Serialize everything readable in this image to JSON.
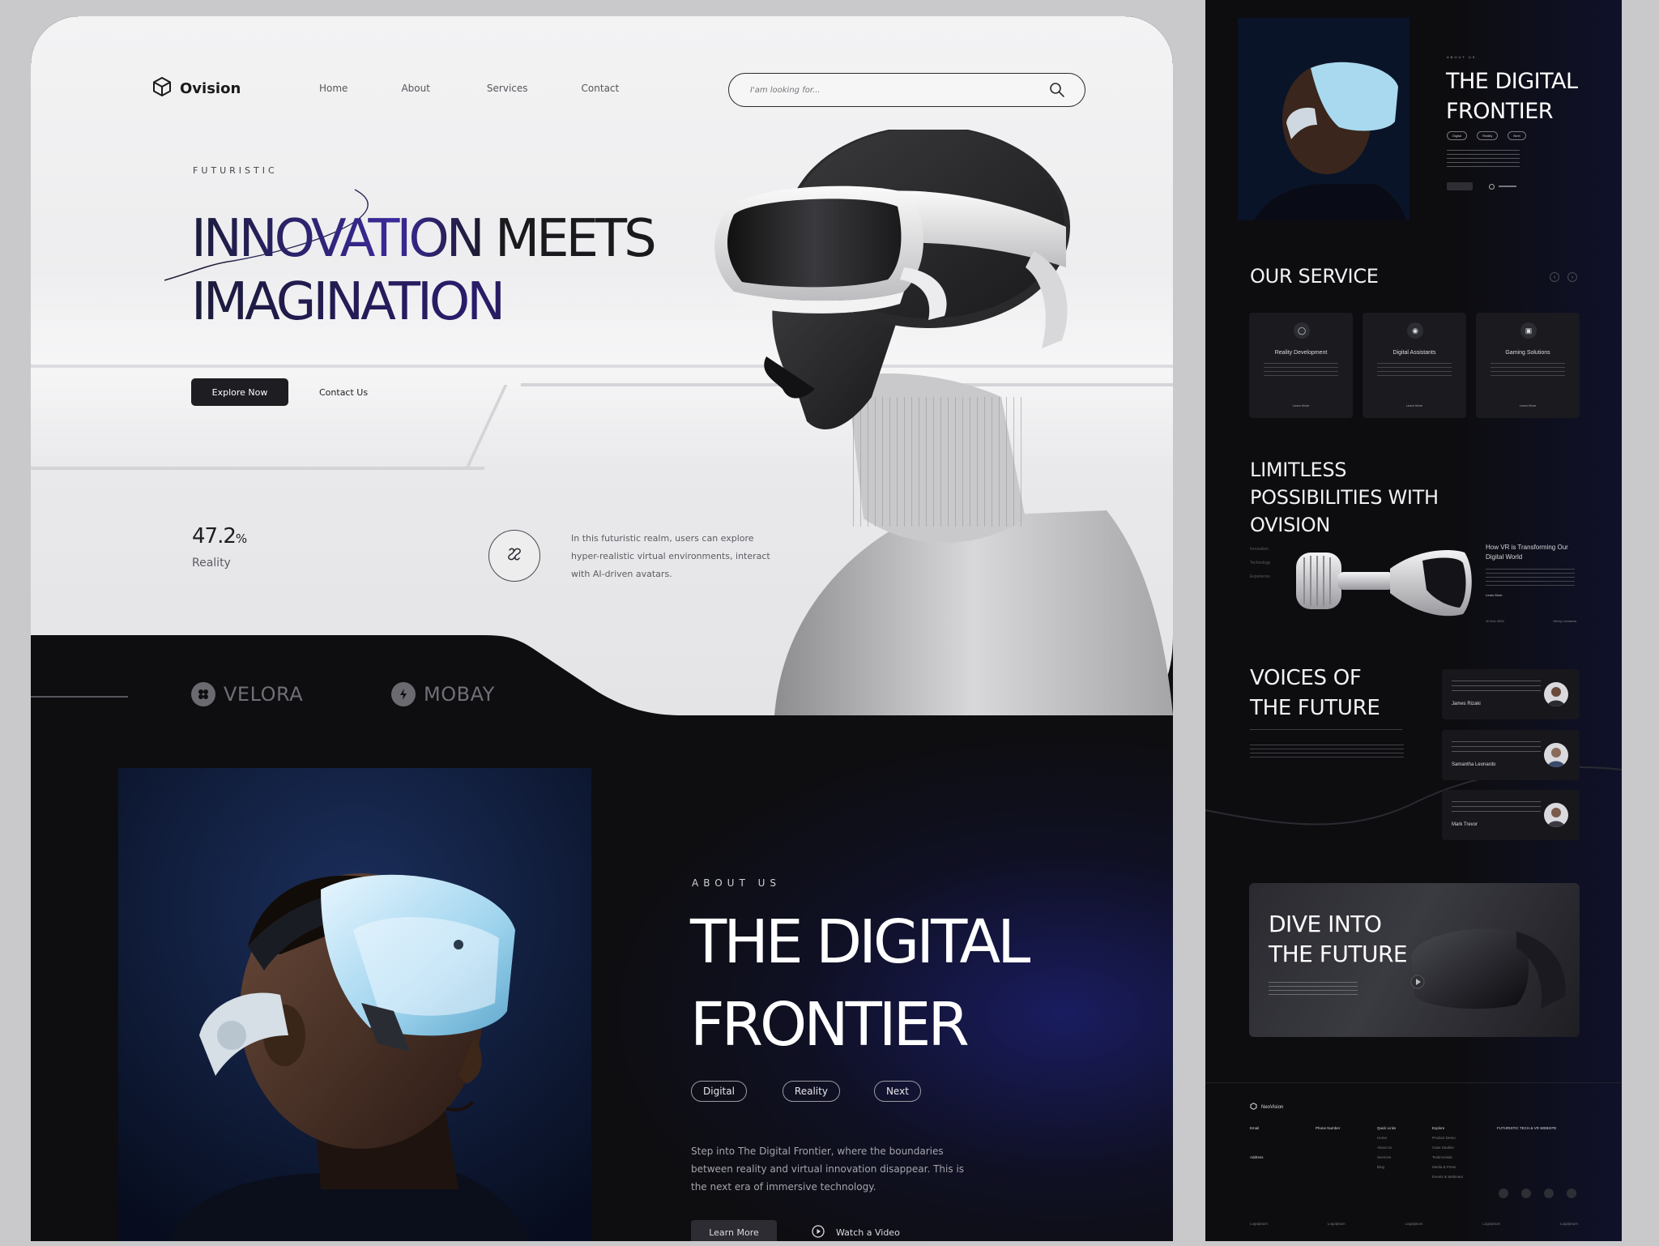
{
  "nav": {
    "brand": "Ovision",
    "links": [
      "Home",
      "About",
      "Services",
      "Contact"
    ],
    "search_placeholder": "I'am looking for..."
  },
  "hero": {
    "eyebrow": "FUTURISTIC",
    "headline_word1": "INNOVATION",
    "headline_word2": "MEETS",
    "headline_line2": "IMAGINATION",
    "primary_button": "Explore Now",
    "secondary_button": "Contact Us",
    "stat_value": "47.2",
    "stat_unit": "%",
    "stat_label": "Reality",
    "description": "In this futuristic realm, users can explore hyper-realistic virtual environments, interact with AI-driven avatars."
  },
  "brands": [
    "VELORA",
    "MOBAY"
  ],
  "about": {
    "eyebrow": "ABOUT US",
    "title_line1": "THE DIGITAL",
    "title_line2": "FRONTIER",
    "tags": [
      "Digital",
      "Reality",
      "Next"
    ],
    "description": "Step into The Digital Frontier, where the boundaries between reality and virtual innovation disappear. This is the next era of immersive technology.",
    "primary_button": "Learn More",
    "watch_label": "Watch a Video"
  },
  "preview": {
    "hero": {
      "eyebrow": "ABOUT US",
      "title_line1": "THE DIGITAL",
      "title_line2": "FRONTIER",
      "tags": [
        "Digital",
        "Reality",
        "Next"
      ]
    },
    "service": {
      "title": "OUR SERVICE",
      "cards": [
        {
          "title": "Reality Development",
          "more": "Learn More"
        },
        {
          "title": "Digital Assistants",
          "more": "Learn More"
        },
        {
          "title": "Gaming Solutions",
          "more": "Learn More"
        }
      ]
    },
    "limitless": {
      "title_line1": "LIMITLESS",
      "title_line2": "POSSIBILITIES WITH",
      "title_line3": "OVISION",
      "side_items": [
        "Innovation",
        "Technology",
        "Experience"
      ],
      "article_title": "How VR is Transforming Our Digital World",
      "article_more": "Learn More",
      "date": "10 Dec 2024",
      "author": "Henry Leonardo"
    },
    "voices": {
      "title_line1": "VOICES OF",
      "title_line2": "THE FUTURE",
      "testimonials": [
        {
          "name": "James Rizaki"
        },
        {
          "name": "Samantha Leonardo"
        },
        {
          "name": "Mark Trevor"
        }
      ]
    },
    "dive": {
      "title_line1": "DIVE INTO",
      "title_line2": "THE FUTURE"
    },
    "footer": {
      "brand": "NeoVision",
      "columns": [
        {
          "head": "Email",
          "items": [
            "Address"
          ]
        },
        {
          "head": "Phone Number",
          "items": []
        },
        {
          "head": "Quick Links",
          "items": [
            "Home",
            "About Us",
            "Services",
            "Blog"
          ]
        },
        {
          "head": "Explore",
          "items": [
            "Product Demo",
            "Case Studies",
            "Testimonials",
            "Media & Press",
            "Events & Webinars"
          ]
        },
        {
          "head": "FUTURISTIC TECH & VR WEBSITE",
          "items": []
        }
      ],
      "logos": [
        "Logoipsum",
        "Logoipsum",
        "Logoipsum",
        "Logoipsum",
        "Logoipsum"
      ]
    }
  },
  "colors": {
    "dark_bg": "#0e0e11",
    "hero_bg": "#ececee",
    "accent_blue": "#2a2a9a",
    "button_dark": "#1d1d22"
  }
}
